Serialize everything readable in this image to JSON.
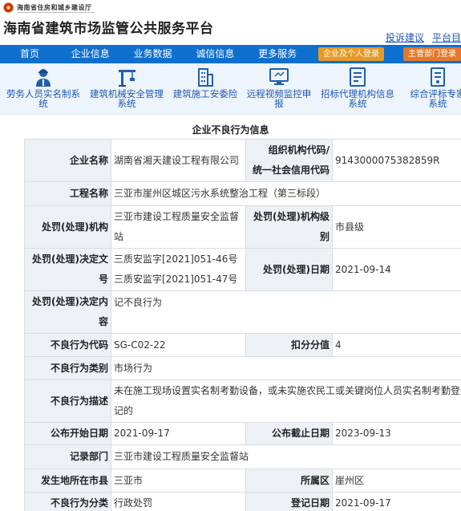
{
  "header": {
    "dept_name": "海南省住房和城乡建设厅",
    "site_title": "海南省建筑市场监管公共服务平台",
    "links": [
      "投诉建议",
      "平台目"
    ]
  },
  "nav": {
    "items": [
      "首页",
      "企业信息",
      "业务数据",
      "诚信信息",
      "更多服务"
    ],
    "login_enterprise": "企业及个人登录",
    "login_department": "主管部门登录"
  },
  "quick_links": [
    {
      "icon": "worker-icon",
      "lines": [
        "劳务人员实名制系",
        "统"
      ]
    },
    {
      "icon": "crane-icon",
      "lines": [
        "建筑机械安全管理",
        "系统"
      ]
    },
    {
      "icon": "building-icon",
      "lines": [
        "建筑施工安委险"
      ]
    },
    {
      "icon": "monitor-icon",
      "lines": [
        "远程视频监控申",
        "报"
      ]
    },
    {
      "icon": "document-icon",
      "lines": [
        "招标代理机构信息",
        "系统"
      ]
    },
    {
      "icon": "evaluation-icon",
      "lines": [
        "综合评标专家",
        "系统"
      ]
    }
  ],
  "section_title": "企业不良行为信息",
  "record": {
    "company_label": "企业名称",
    "company": "湖南省湘天建设工程有限公司",
    "org_code_label_1": "组织机构代码/",
    "org_code_label_2": "统一社会信用代码",
    "org_code": "9143000075382859R",
    "project_label": "工程名称",
    "project": "三亚市崖州区城区污水系统整治工程（第三标段）",
    "agency_label": "处罚(处理)机构",
    "agency_1": "三亚市建设工程质量安全监督",
    "agency_2": "站",
    "agency_level_label_1": "处罚(处理)机构级",
    "agency_level_label_2": "别",
    "agency_level": "市县级",
    "decision_no_label_1": "处罚(处理)决定文",
    "decision_no_label_2": "号",
    "decision_no_1": "三质安监字[2021]051-46号",
    "decision_no_2": "三质安监字[2021]051-47号",
    "decision_date_label": "处罚(处理)日期",
    "decision_date": "2021-09-14",
    "decision_content_label_1": "处罚(处理)决定内",
    "decision_content_label_2": "容",
    "decision_content": "记不良行为",
    "code_label": "不良行为代码",
    "code": "SG-C02-22",
    "deduction_label": "扣分分值",
    "deduction": "4",
    "category_label": "不良行为类别",
    "category": "市场行为",
    "description_label": "不良行为描述",
    "description_1": "未在施工现场设置实名制考勤设备，或未实施农民工或关键岗位人员实名制考勤登",
    "description_2": "记的",
    "publish_start_label": "公布开始日期",
    "publish_start": "2021-09-17",
    "publish_end_label": "公布截止日期",
    "publish_end": "2023-09-13",
    "record_dept_label": "记录部门",
    "record_dept": "三亚市建设工程质量安全监督站",
    "city_label": "发生地所在市县",
    "city": "三亚市",
    "district_label": "所属区",
    "district": "崖州区",
    "classification_label": "不良行为分类",
    "classification": "行政处罚",
    "register_date_label": "登记日期",
    "register_date": "2021-09-17"
  },
  "colors": {
    "nav_blue": "#0f6fcf",
    "link_blue": "#1a56b3",
    "login_orange": "#e79a27",
    "label_bg": "#edf1f6"
  }
}
